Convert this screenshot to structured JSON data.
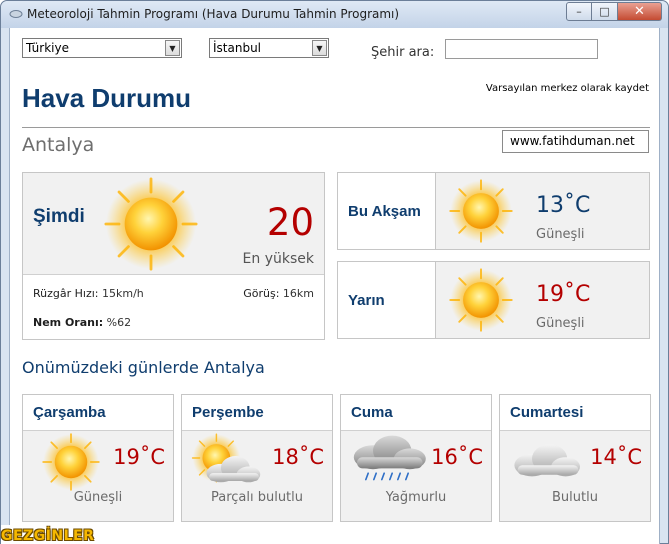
{
  "window": {
    "title": "Meteoroloji Tahmin Programı (Hava Durumu Tahmin Programı)",
    "minimize_icon": "minimize-icon",
    "maximize_icon": "maximize-icon",
    "close_icon": "close-icon"
  },
  "controls": {
    "country": "Türkiye",
    "city": "İstanbul",
    "search_label": "Şehir ara:",
    "search_value": "",
    "save_default": "Varsayılan merkez olarak kaydet"
  },
  "header": {
    "title": "Hava Durumu",
    "city": "Antalya",
    "site": "www.fatihduman.net"
  },
  "now": {
    "label": "Şimdi",
    "temp": "20",
    "sub": "En yüksek",
    "icon": "sun-icon",
    "wind_label": "Rüzgâr Hızı:",
    "wind_value": "15km/h",
    "visibility_label": "Görüş:",
    "visibility_value": "16km",
    "humidity_label": "Nem Oranı:",
    "humidity_value": "%62"
  },
  "evening": {
    "label": "Bu Akşam",
    "temp": "13˚C",
    "cond": "Güneşli",
    "icon": "sun-icon"
  },
  "tomorrow": {
    "label": "Yarın",
    "temp": "19˚C",
    "cond": "Güneşli",
    "icon": "sun-icon"
  },
  "section_title": "Onümüzdeki günlerde Antalya",
  "days": [
    {
      "name": "Çarşamba",
      "temp": "19˚C",
      "cond": "Güneşli",
      "icon": "sun-icon"
    },
    {
      "name": "Perşembe",
      "temp": "18˚C",
      "cond": "Parçalı bulutlu",
      "icon": "partly-cloudy-icon"
    },
    {
      "name": "Cuma",
      "temp": "16˚C",
      "cond": "Yağmurlu",
      "icon": "rain-cloud-icon"
    },
    {
      "name": "Cumartesi",
      "temp": "14˚C",
      "cond": "Bulutlu",
      "icon": "cloud-icon"
    }
  ],
  "footer": {
    "logo": "GEZGİNLER"
  },
  "colors": {
    "accent_blue": "#0f3d6e",
    "temp_red": "#b40000",
    "panel_bg": "#f1f1f1",
    "sun_yellow": "#f7b500"
  }
}
